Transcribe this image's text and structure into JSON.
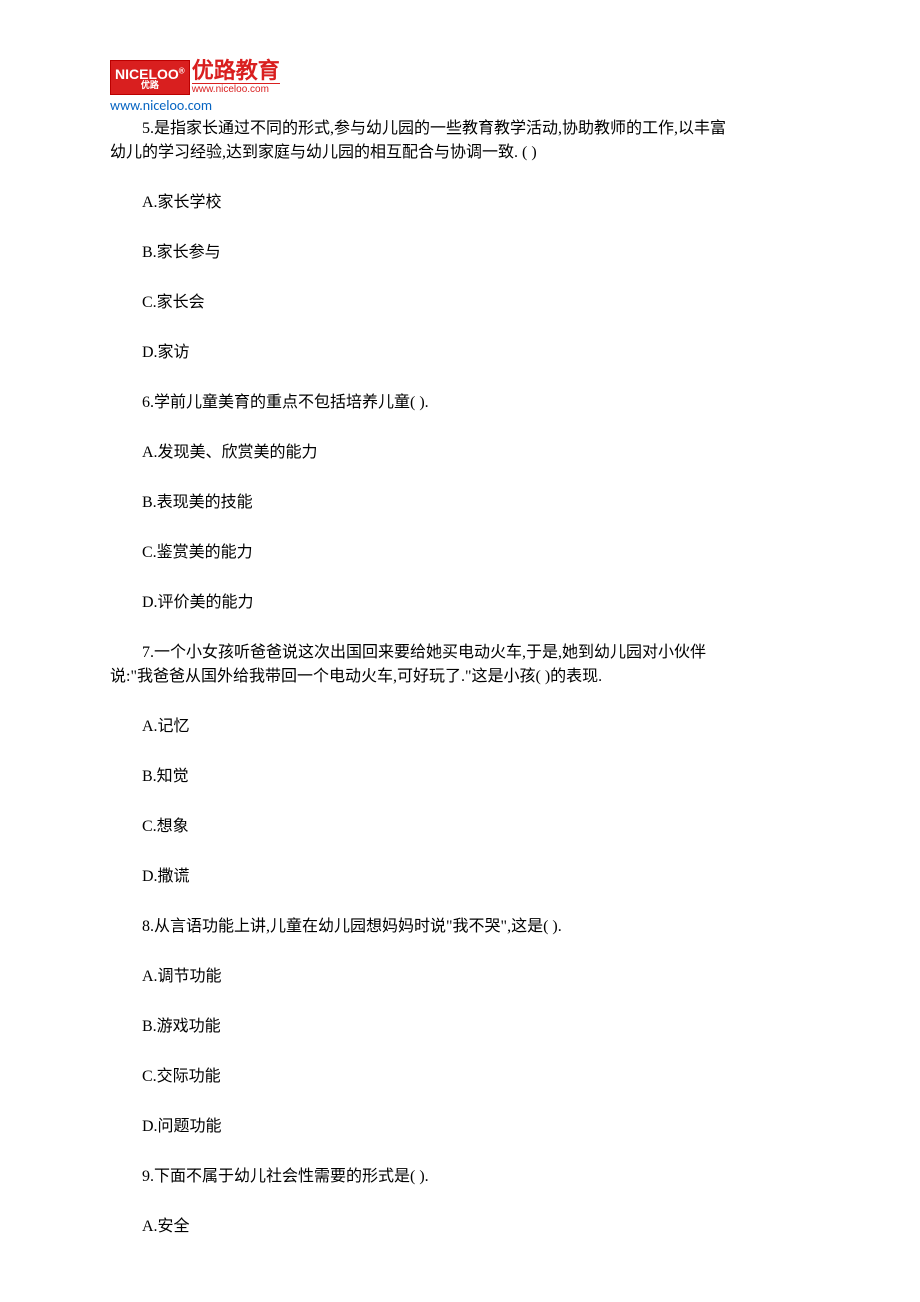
{
  "header": {
    "logo_badge": "NICELOO",
    "logo_sup": "®",
    "logo_sub": "优路",
    "logo_cn": "优路教育",
    "logo_url_small": "www.niceloo.com",
    "url": "www.niceloo.com"
  },
  "questions": [
    {
      "stem_lines": [
        "5.是指家长通过不同的形式,参与幼儿园的一些教育教学活动,协助教师的工作,以丰富",
        "幼儿的学习经验,达到家庭与幼儿园的相互配合与协调一致.  ( )"
      ],
      "options": [
        "A.家长学校",
        "B.家长参与",
        "C.家长会",
        "D.家访"
      ]
    },
    {
      "stem_lines": [
        "6.学前儿童美育的重点不包括培养儿童( )."
      ],
      "options": [
        "A.发现美、欣赏美的能力",
        "B.表现美的技能",
        "C.鉴赏美的能力",
        "D.评价美的能力"
      ]
    },
    {
      "stem_lines": [
        "7.一个小女孩听爸爸说这次出国回来要给她买电动火车,于是,她到幼儿园对小伙伴",
        "说:\"我爸爸从国外给我带回一个电动火车,可好玩了.\"这是小孩( )的表现."
      ],
      "options": [
        "A.记忆",
        "B.知觉",
        "C.想象",
        "D.撒谎"
      ]
    },
    {
      "stem_lines": [
        "8.从言语功能上讲,儿童在幼儿园想妈妈时说\"我不哭\",这是( )."
      ],
      "options": [
        "A.调节功能",
        "B.游戏功能",
        "C.交际功能",
        "D.问题功能"
      ]
    },
    {
      "stem_lines": [
        "9.下面不属于幼儿社会性需要的形式是( )."
      ],
      "options": [
        "A.安全"
      ]
    }
  ]
}
